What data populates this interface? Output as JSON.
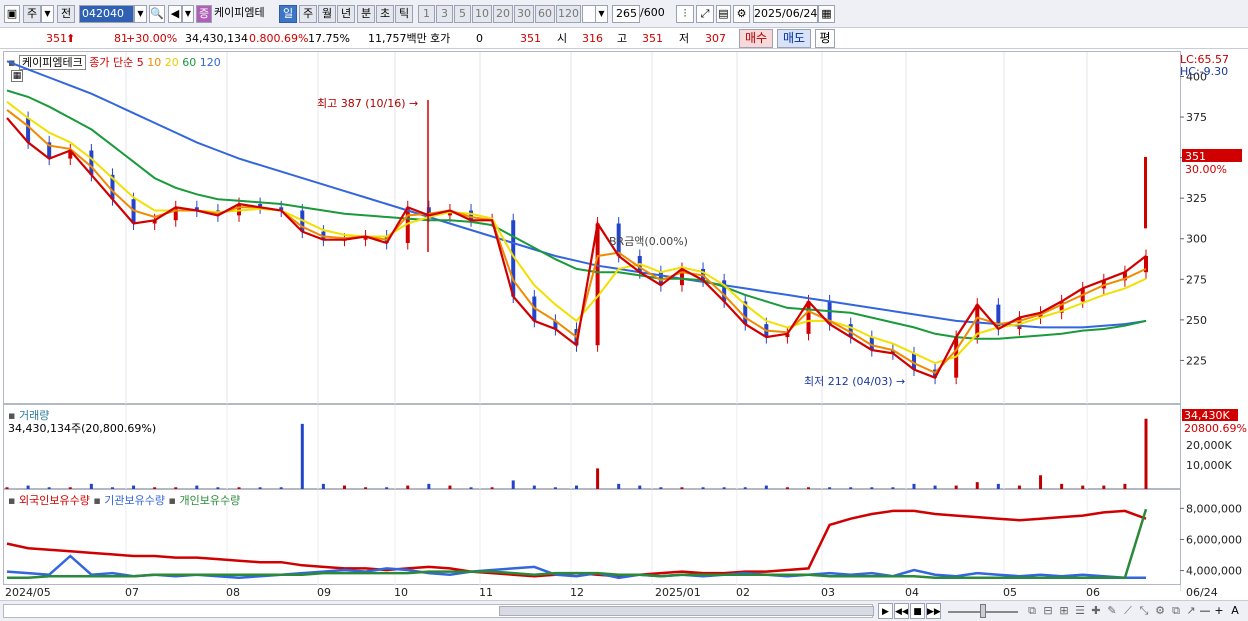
{
  "toolbar": {
    "mode": "주",
    "prev": "전",
    "code": "042040",
    "stock_name": "케이피엠테",
    "period_day": "일",
    "period_week": "주",
    "period_month": "월",
    "period_year": "년",
    "period_min": "분",
    "period_sec": "초",
    "period_tick": "틱",
    "intervals": [
      "1",
      "3",
      "5",
      "10",
      "20",
      "30",
      "60",
      "120"
    ],
    "count": "265",
    "count_total": "/600",
    "date": "2025/06/24",
    "icon_names": [
      "layout-icon",
      "dropdown-icon",
      "search-icon",
      "speaker-icon",
      "zoom-icon",
      "candle-icon",
      "compare-icon",
      "save-icon",
      "gear-icon",
      "calendar-icon"
    ]
  },
  "quote": {
    "price": "351",
    "change": "81",
    "change_pct": "+30.00%",
    "volume": "34,430,134",
    "vol_ratio": "0.800.69%",
    "turnover": "17.75%",
    "amount": "11,757백만",
    "hoga_label": "호가",
    "hoga_value": "0",
    "hoga_price": "351",
    "open_label": "시",
    "open": "316",
    "high_label": "고",
    "high": "351",
    "low_label": "저",
    "low": "307",
    "buy": "매수",
    "sell": "매도",
    "avg": "평"
  },
  "price_panel": {
    "name": "케이피엠테크",
    "label_close": "종가",
    "label_simple": "단순",
    "ma_periods": [
      "5",
      "10",
      "20",
      "60",
      "120"
    ],
    "ma_colors": [
      "#d00000",
      "#f08a00",
      "#f2e000",
      "#1a9a3a",
      "#3366dd"
    ],
    "lc": "LC:65.57",
    "hc": "HC:-9.30",
    "high_annotation": "최고 387 (10/16)",
    "low_annotation": "최저 212 (04/03)",
    "mid_annotation": "BR금액(0.00%)",
    "last_price": "351",
    "last_pct": "30.00%"
  },
  "volume_panel": {
    "title": "거래량",
    "info": "34,430,134주(20,800.69%)",
    "last": "34,430K",
    "pct": "20800.69%"
  },
  "holder_panel": {
    "foreign": "외국인보유수량",
    "institution": "기관보유수량",
    "individual": "개인보유수량"
  },
  "x_axis": [
    "2024/05",
    "07",
    "08",
    "09",
    "10",
    "11",
    "12",
    "2025/01",
    "02",
    "03",
    "04",
    "05",
    "06",
    "06/24"
  ],
  "chart_data": [
    {
      "type": "line",
      "title": "케이피엠테크",
      "ylim": [
        200,
        412
      ],
      "y_ticks": [
        225,
        250,
        275,
        300,
        325,
        350,
        375,
        400
      ],
      "x_labels": [
        "2024/05",
        "07",
        "08",
        "09",
        "10",
        "11",
        "12",
        "2025/01",
        "02",
        "03",
        "04",
        "05",
        "06"
      ],
      "series": [
        {
          "name": "5",
          "color": "#d00000",
          "values": [
            375,
            360,
            350,
            355,
            340,
            325,
            310,
            312,
            320,
            318,
            315,
            322,
            320,
            318,
            305,
            300,
            300,
            302,
            298,
            320,
            315,
            318,
            312,
            312,
            265,
            250,
            245,
            235,
            310,
            290,
            280,
            272,
            282,
            275,
            262,
            248,
            240,
            242,
            262,
            248,
            240,
            232,
            230,
            220,
            215,
            240,
            260,
            245,
            252,
            255,
            262,
            270,
            275,
            280,
            290
          ]
        },
        {
          "name": "10",
          "color": "#f08a00",
          "values": [
            380,
            370,
            358,
            356,
            345,
            330,
            318,
            314,
            318,
            318,
            316,
            320,
            320,
            318,
            308,
            302,
            301,
            302,
            300,
            315,
            316,
            318,
            314,
            312,
            275,
            258,
            250,
            240,
            290,
            292,
            283,
            275,
            280,
            278,
            266,
            252,
            244,
            243,
            256,
            250,
            243,
            235,
            232,
            224,
            218,
            232,
            252,
            248,
            250,
            254,
            260,
            266,
            272,
            276,
            282
          ]
        },
        {
          "name": "20",
          "color": "#f2e000",
          "values": [
            385,
            375,
            366,
            360,
            350,
            338,
            326,
            318,
            318,
            318,
            317,
            318,
            319,
            318,
            312,
            306,
            303,
            302,
            302,
            310,
            314,
            317,
            316,
            313,
            290,
            272,
            260,
            250,
            265,
            282,
            285,
            280,
            283,
            280,
            272,
            260,
            250,
            246,
            250,
            250,
            246,
            240,
            236,
            230,
            224,
            228,
            242,
            246,
            248,
            252,
            256,
            261,
            266,
            270,
            276
          ]
        },
        {
          "name": "60",
          "color": "#1a9a3a",
          "values": [
            392,
            388,
            382,
            375,
            368,
            358,
            348,
            338,
            332,
            328,
            325,
            324,
            323,
            322,
            320,
            318,
            316,
            315,
            314,
            313,
            312,
            312,
            311,
            309,
            302,
            295,
            288,
            282,
            280,
            280,
            278,
            276,
            276,
            275,
            271,
            266,
            262,
            258,
            257,
            256,
            255,
            252,
            249,
            246,
            242,
            240,
            239,
            239,
            240,
            241,
            242,
            244,
            245,
            247,
            250
          ]
        },
        {
          "name": "120",
          "color": "#3366dd",
          "values": [
            410,
            405,
            400,
            395,
            390,
            384,
            378,
            372,
            366,
            360,
            355,
            350,
            346,
            342,
            338,
            334,
            330,
            326,
            322,
            318,
            314,
            310,
            306,
            302,
            298,
            294,
            290,
            287,
            284,
            282,
            280,
            278,
            276,
            274,
            272,
            270,
            268,
            266,
            264,
            262,
            260,
            258,
            256,
            254,
            252,
            250,
            249,
            248,
            247,
            246,
            246,
            246,
            247,
            248,
            250
          ]
        }
      ]
    },
    {
      "type": "bar",
      "title": "거래량",
      "y_ticks": [
        "10,000K",
        "20,000K"
      ],
      "volumes": [
        1,
        2,
        1,
        1,
        3,
        1,
        2,
        1,
        1,
        2,
        1,
        1,
        1,
        1,
        38,
        3,
        2,
        1,
        1,
        2,
        3,
        2,
        1,
        1,
        5,
        2,
        1,
        2,
        12,
        3,
        2,
        1,
        1,
        1,
        1,
        1,
        2,
        1,
        1,
        1,
        1,
        1,
        1,
        3,
        2,
        2,
        4,
        3,
        2,
        8,
        3,
        2,
        2,
        3,
        41
      ]
    },
    {
      "type": "line",
      "title": "보유수량",
      "y_ticks": [
        "4,000,000",
        "6,000,000",
        "8,000,000"
      ],
      "series": [
        {
          "name": "외국인보유수량",
          "color": "#d00000",
          "values": [
            5.8,
            5.5,
            5.4,
            5.3,
            5.2,
            5.1,
            5.0,
            5.0,
            4.9,
            4.9,
            4.8,
            4.7,
            4.6,
            4.6,
            4.4,
            4.3,
            4.2,
            4.2,
            4.1,
            4.2,
            4.3,
            4.2,
            4.0,
            3.9,
            3.8,
            3.7,
            3.8,
            3.9,
            3.8,
            3.7,
            3.8,
            3.9,
            4.0,
            3.9,
            3.9,
            4.0,
            4.0,
            4.1,
            4.2,
            7.0,
            7.4,
            7.7,
            7.9,
            7.9,
            7.7,
            7.6,
            7.5,
            7.4,
            7.3,
            7.4,
            7.5,
            7.6,
            7.8,
            7.9,
            7.4
          ]
        },
        {
          "name": "기관보유수량",
          "color": "#3366dd",
          "values": [
            4.0,
            3.9,
            3.8,
            5.0,
            3.8,
            3.9,
            3.7,
            3.8,
            3.7,
            3.8,
            3.7,
            3.6,
            3.7,
            3.8,
            3.9,
            4.0,
            4.1,
            4.0,
            4.2,
            4.1,
            3.9,
            3.8,
            4.0,
            4.1,
            4.2,
            4.3,
            3.8,
            3.7,
            3.9,
            3.6,
            3.8,
            3.7,
            3.8,
            3.7,
            3.8,
            3.9,
            3.8,
            3.7,
            3.8,
            3.9,
            3.8,
            3.9,
            3.7,
            4.1,
            3.8,
            3.7,
            3.9,
            3.8,
            3.7,
            3.8,
            3.7,
            3.8,
            3.7,
            3.6,
            3.6
          ]
        },
        {
          "name": "개인보유수량",
          "color": "#2a8a3a",
          "values": [
            3.6,
            3.6,
            3.7,
            3.7,
            3.7,
            3.7,
            3.7,
            3.8,
            3.8,
            3.8,
            3.8,
            3.8,
            3.8,
            3.8,
            3.8,
            3.9,
            3.9,
            3.9,
            3.9,
            3.9,
            4.0,
            4.0,
            4.0,
            4.0,
            3.9,
            3.8,
            3.9,
            3.9,
            3.9,
            3.8,
            3.8,
            3.7,
            3.8,
            3.8,
            3.8,
            3.8,
            3.8,
            3.8,
            3.8,
            3.7,
            3.7,
            3.7,
            3.7,
            3.7,
            3.6,
            3.6,
            3.6,
            3.6,
            3.6,
            3.6,
            3.6,
            3.6,
            3.6,
            3.6,
            8.0
          ]
        }
      ]
    }
  ]
}
